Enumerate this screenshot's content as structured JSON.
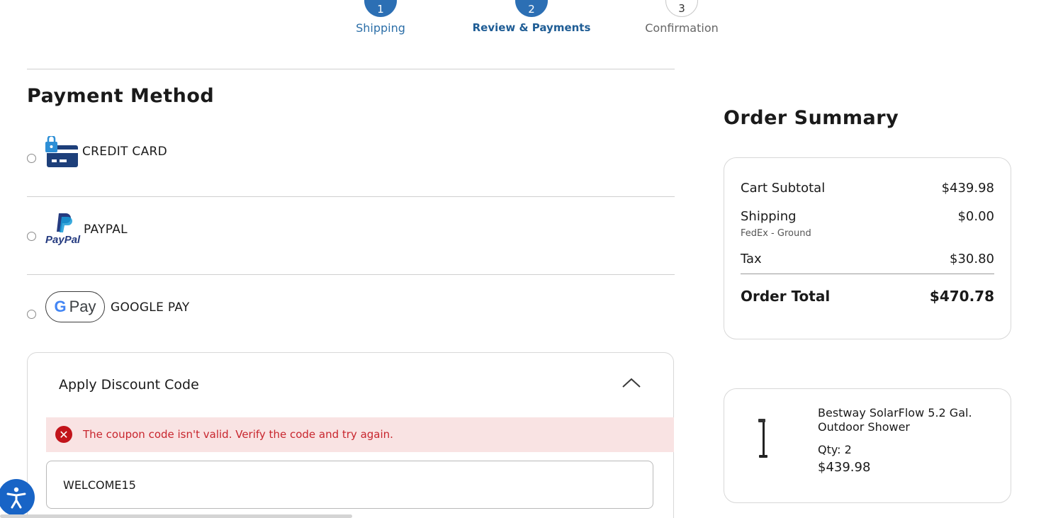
{
  "stepper": {
    "steps": [
      {
        "number": "1",
        "label": "Shipping"
      },
      {
        "number": "2",
        "label": "Review & Payments"
      },
      {
        "number": "3",
        "label": "Confirmation"
      }
    ]
  },
  "payment": {
    "title": "Payment Method",
    "options": [
      {
        "label": "CREDIT CARD",
        "icon": "credit-card-lock-icon"
      },
      {
        "label": "PAYPAL",
        "icon": "paypal-logo",
        "logo_text": "PayPal"
      },
      {
        "label": "GOOGLE PAY",
        "icon": "google-pay-logo",
        "logo_text": "Pay"
      }
    ]
  },
  "discount": {
    "title": "Apply Discount Code",
    "error": "The coupon code isn't valid. Verify the code and try again.",
    "code_value": "WELCOME15"
  },
  "summary": {
    "title": "Order Summary",
    "subtotal_label": "Cart Subtotal",
    "subtotal_value": "$439.98",
    "shipping_label": "Shipping",
    "shipping_value": "$0.00",
    "shipping_method": "FedEx - Ground",
    "tax_label": "Tax",
    "tax_value": "$30.80",
    "total_label": "Order Total",
    "total_value": "$470.78"
  },
  "cart_item": {
    "name": "Bestway SolarFlow 5.2 Gal. Outdoor Shower",
    "qty": "Qty: 2",
    "price": "$439.98"
  },
  "colors": {
    "brand_blue": "#2c6fb4",
    "error_red": "#c2141b",
    "error_bg": "#f9e3e3",
    "a11y_blue": "#1864c6"
  }
}
